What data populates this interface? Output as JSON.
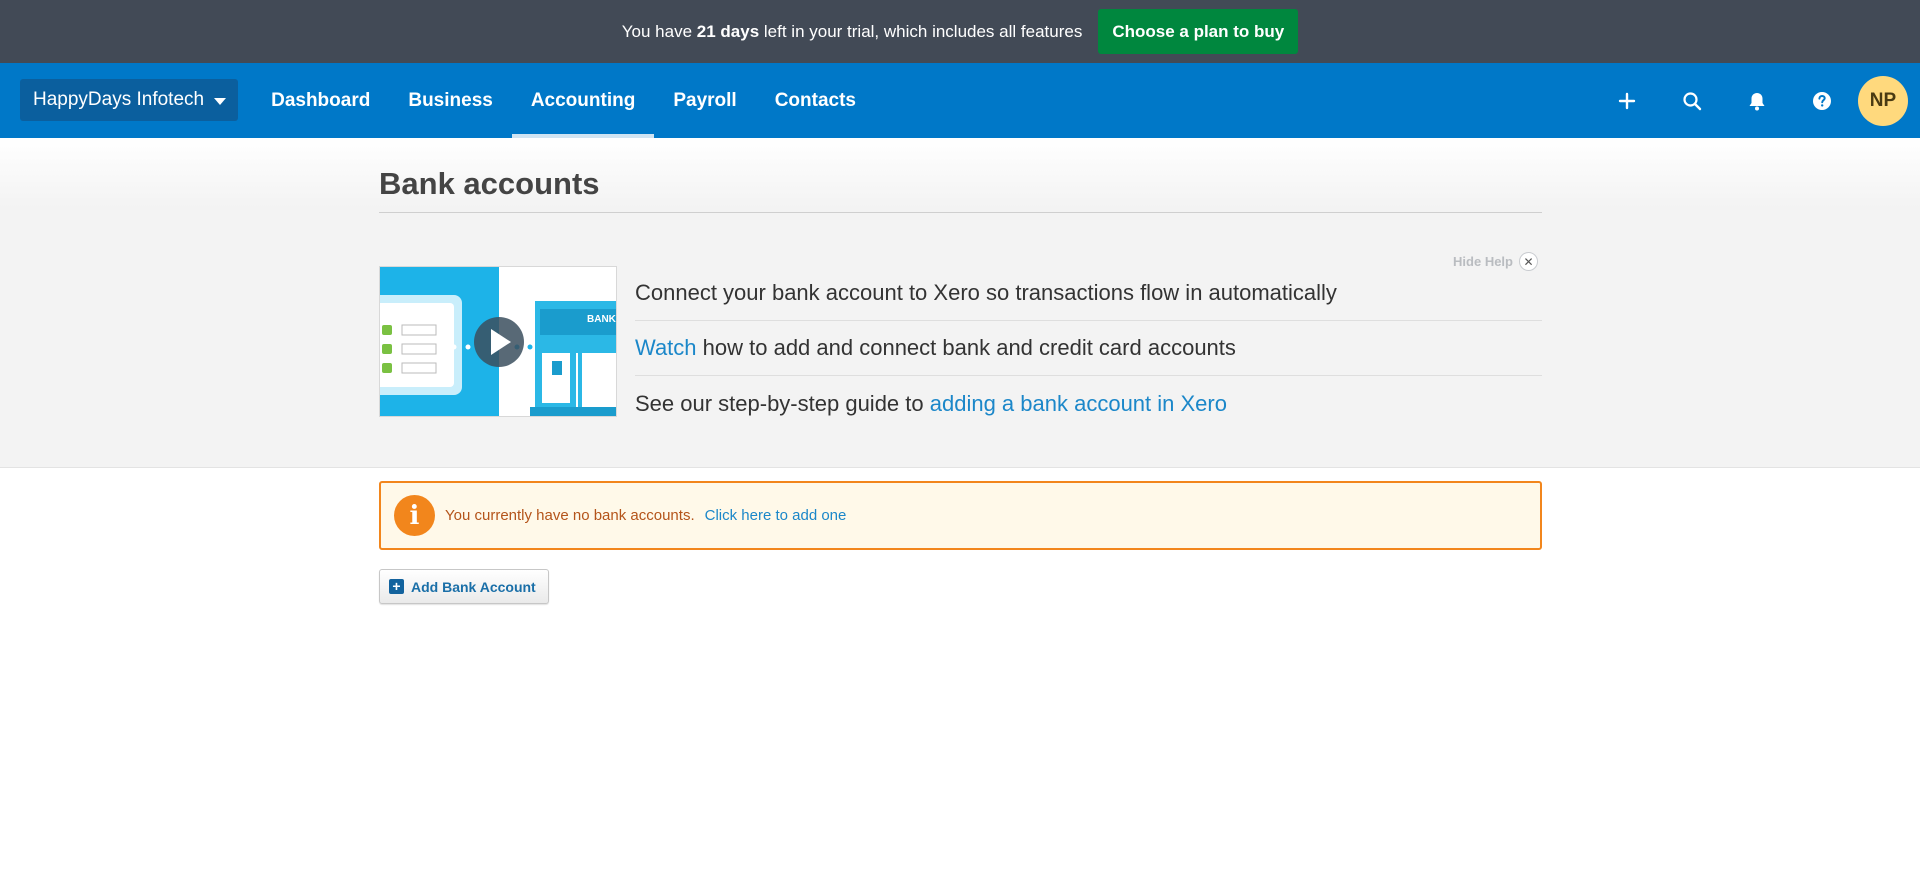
{
  "trial_banner": {
    "prefix": "You have",
    "days": "21 days",
    "suffix": "left in your trial, which includes all features",
    "cta": "Choose a plan to buy"
  },
  "nav": {
    "org_name": "HappyDays Infotech",
    "links": [
      "Dashboard",
      "Business",
      "Accounting",
      "Payroll",
      "Contacts"
    ],
    "active": "Accounting",
    "icons": [
      "plus-icon",
      "search-icon",
      "bell-icon",
      "help-icon"
    ],
    "avatar_initials": "NP"
  },
  "page": {
    "title": "Bank accounts"
  },
  "help": {
    "hide_label": "Hide Help",
    "video_thumbnail_label": "BANK",
    "line1": "Connect your bank account to Xero so transactions flow in automatically",
    "line2_link": "Watch",
    "line2_text": "how to add and connect bank and credit card accounts",
    "line3_text": "See our step-by-step guide to",
    "line3_link": "adding a bank account in Xero"
  },
  "notice": {
    "text": "You currently have no bank accounts.",
    "link": "Click here to add one"
  },
  "actions": {
    "add_bank_account": "Add Bank Account"
  },
  "colors": {
    "banner_bg": "#424a56",
    "nav_bg": "#0078c8",
    "cta_green": "#00873e",
    "link_blue": "#1b87c9",
    "notice_orange": "#f2861c"
  }
}
